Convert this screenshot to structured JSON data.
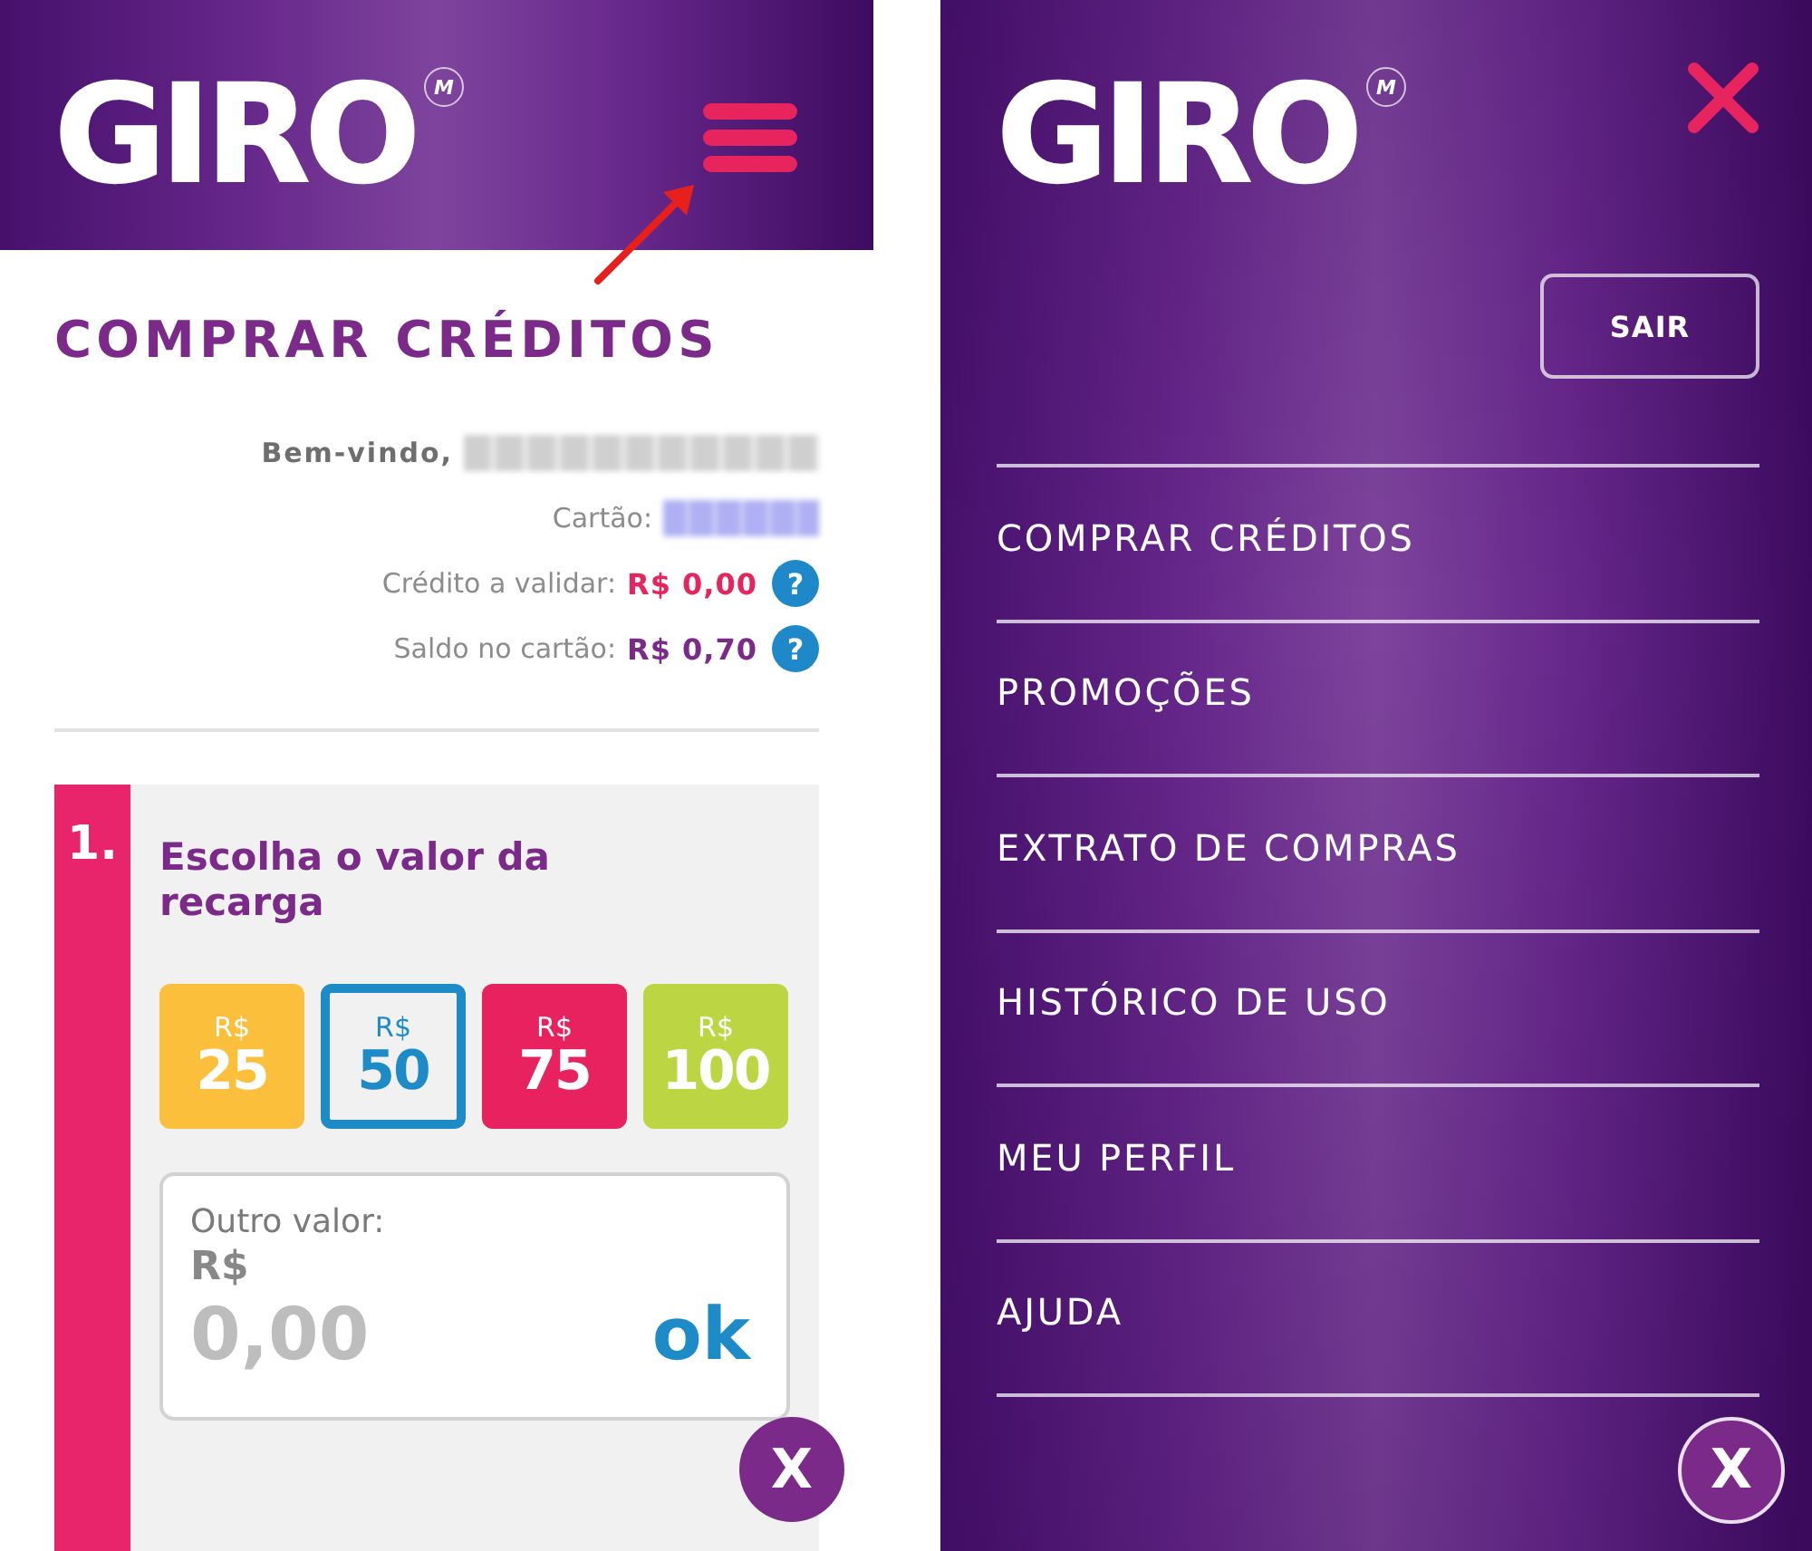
{
  "purchase_screen": {
    "header": {
      "logo": "GIRO",
      "logo_mark": "M"
    },
    "annotations": [
      {
        "kind": "arrow"
      }
    ],
    "title": "COMPRAR CRÉDITOS",
    "account": [
      {
        "kind": "welcome",
        "label": "Bem-vindo,",
        "blurred": true
      },
      {
        "kind": "card",
        "label": "Cartão:",
        "blurred": true
      }
    ],
    "balances": [
      {
        "label": "Crédito a validar:",
        "value": "R$ 0,00",
        "color": "#e6245e",
        "help": "?"
      },
      {
        "label": "Saldo no cartão:",
        "value": "R$ 0,70",
        "color": "#7b2a8a",
        "help": "?"
      }
    ],
    "step": {
      "number": "1.",
      "title": "Escolha o valor da recarga",
      "amounts": [
        {
          "currency": "R$",
          "value": "25",
          "color": "#fbbf3c",
          "selected": false
        },
        {
          "currency": "R$",
          "value": "50",
          "color": "#1e8bc9",
          "selected": true
        },
        {
          "currency": "R$",
          "value": "75",
          "color": "#e8215f",
          "selected": false
        },
        {
          "currency": "R$",
          "value": "100",
          "color": "#bcd543",
          "selected": false
        }
      ],
      "other_value": {
        "label": "Outro valor:",
        "currency": "R$",
        "placeholder": "0,00",
        "action": "ok"
      }
    },
    "close_button": "X"
  },
  "menu_screen": {
    "header": {
      "logo": "GIRO",
      "logo_mark": "M"
    },
    "logout_button": "SAIR",
    "items": [
      "COMPRAR CRÉDITOS",
      "PROMOÇÕES",
      "EXTRATO DE COMPRAS",
      "HISTÓRICO DE USO",
      "MEU PERFIL",
      "AJUDA"
    ],
    "close_button": "X"
  }
}
